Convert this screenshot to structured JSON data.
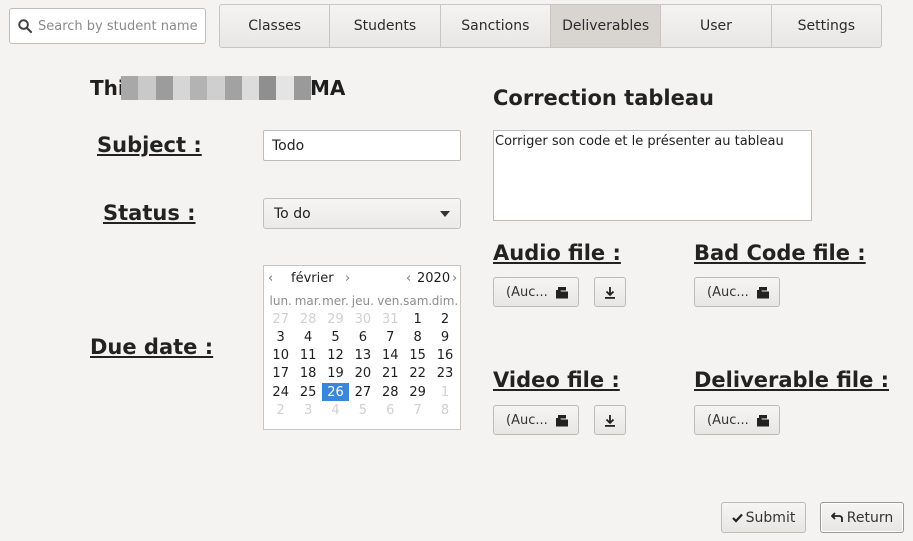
{
  "search": {
    "placeholder": "Search by student name",
    "icon": "search-icon"
  },
  "nav": {
    "tabs": [
      {
        "label": "Classes"
      },
      {
        "label": "Students"
      },
      {
        "label": "Sanctions"
      },
      {
        "label": "Deliverables",
        "active": true
      },
      {
        "label": "User"
      },
      {
        "label": "Settings"
      }
    ]
  },
  "student": {
    "name_start": "Thi",
    "name_end": "MA"
  },
  "form": {
    "subject_label": "Subject :",
    "subject_value": "Todo",
    "status_label": "Status :",
    "status_value": "To do",
    "due_label": "Due date :"
  },
  "calendar": {
    "month": "février",
    "year": "2020",
    "days_of_week": [
      "lun.",
      "mar.",
      "mer.",
      "jeu.",
      "ven.",
      "sam.",
      "dim."
    ],
    "weeks": [
      [
        "27",
        "28",
        "29",
        "30",
        "31",
        "1",
        "2"
      ],
      [
        "3",
        "4",
        "5",
        "6",
        "7",
        "8",
        "9"
      ],
      [
        "10",
        "11",
        "12",
        "13",
        "14",
        "15",
        "16"
      ],
      [
        "17",
        "18",
        "19",
        "20",
        "21",
        "22",
        "23"
      ],
      [
        "24",
        "25",
        "26",
        "27",
        "28",
        "29",
        "1"
      ],
      [
        "2",
        "3",
        "4",
        "5",
        "6",
        "7",
        "8"
      ]
    ],
    "selected_day": "26"
  },
  "correction": {
    "title": "Correction tableau",
    "text": "Corriger son code et le présenter au tableau"
  },
  "files": {
    "audio_label": "Audio file :",
    "bad_code_label": "Bad Code file :",
    "video_label": "Video file :",
    "deliverable_label": "Deliverable file :",
    "placeholder": "(Auc..."
  },
  "actions": {
    "submit": "Submit",
    "return": "Return"
  },
  "colors": {
    "accent_selected_day": "#3a86d9",
    "active_tab": "#d8d5d1"
  }
}
